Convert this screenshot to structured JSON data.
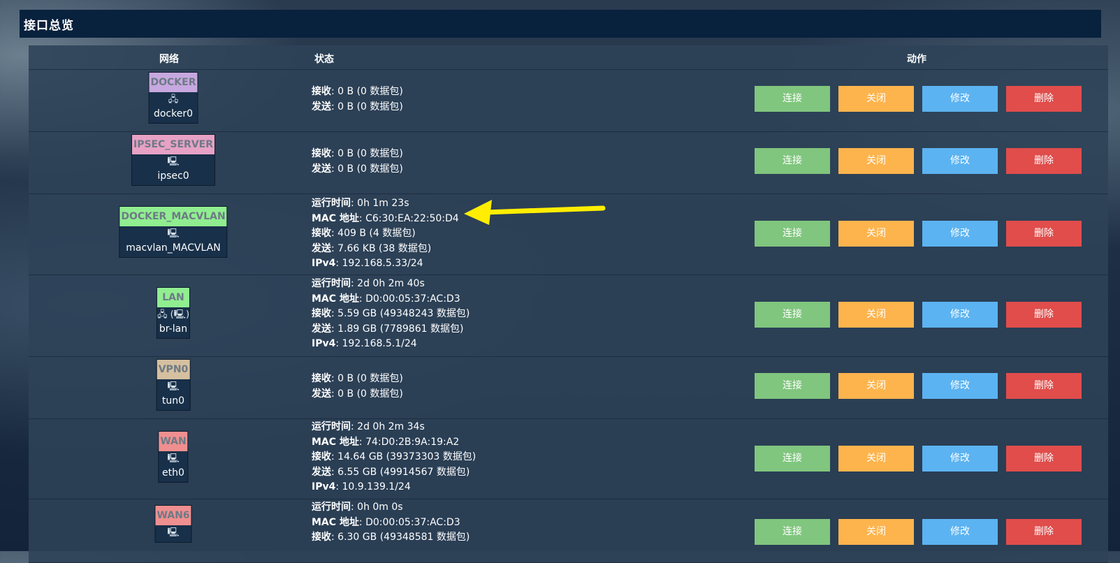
{
  "page": {
    "title": "接口总览"
  },
  "table": {
    "col_network": "网络",
    "col_status": "状态",
    "col_actions": "动作"
  },
  "actions": {
    "connect": "连接",
    "stop": "关闭",
    "edit": "修改",
    "delete": "删除"
  },
  "labels": {
    "uptime": "运行时间",
    "mac": "MAC 地址",
    "rx": "接收",
    "tx": "发送",
    "ipv4": "IPv4"
  },
  "interfaces": [
    {
      "name": "DOCKER",
      "color": "#c7a8e0",
      "device": "docker0",
      "icon": "bridge-icon",
      "rx": "0 B (0 数据包)",
      "tx": "0 B (0 数据包)"
    },
    {
      "name": "IPSEC_SERVER",
      "color": "#e7a1c5",
      "device": "ipsec0",
      "icon": "ethernet-icon",
      "rx": "0 B (0 数据包)",
      "tx": "0 B (0 数据包)"
    },
    {
      "name": "DOCKER_MACVLAN",
      "color": "#90ee90",
      "device": "macvlan_MACVLAN",
      "icon": "ethernet-icon",
      "uptime": "0h 1m 23s",
      "mac": "C6:30:EA:22:50:D4",
      "rx": "409 B (4 数据包)",
      "tx": "7.66 KB (38 数据包)",
      "ipv4": "192.168.5.33/24"
    },
    {
      "name": "LAN",
      "color": "#90ee90",
      "device": "br-lan",
      "icon": "bridge-icon",
      "uptime": "2d 0h 2m 40s",
      "mac": "D0:00:05:37:AC:D3",
      "rx": "5.59 GB (49348243 数据包)",
      "tx": "1.89 GB (7789861 数据包)",
      "ipv4": "192.168.5.1/24"
    },
    {
      "name": "VPN0",
      "color": "#d5c0a0",
      "device": "tun0",
      "icon": "ethernet-icon",
      "rx": "0 B (0 数据包)",
      "tx": "0 B (0 数据包)"
    },
    {
      "name": "WAN",
      "color": "#f08f8f",
      "device": "eth0",
      "icon": "ethernet-icon",
      "uptime": "2d 0h 2m 34s",
      "mac": "74:D0:2B:9A:19:A2",
      "rx": "14.64 GB (39373303 数据包)",
      "tx": "6.55 GB (49914567 数据包)",
      "ipv4": "10.9.139.1/24"
    },
    {
      "name": "WAN6",
      "color": "#f08f8f",
      "device": "",
      "icon": "ethernet-icon",
      "uptime": "0h 0m 0s",
      "mac": "D0:00:05:37:AC:D3",
      "rx": "6.30 GB (49348581 数据包)"
    }
  ],
  "annotation": {
    "arrow_color": "#ffee00",
    "icon": "arrow-annotation-icon"
  }
}
